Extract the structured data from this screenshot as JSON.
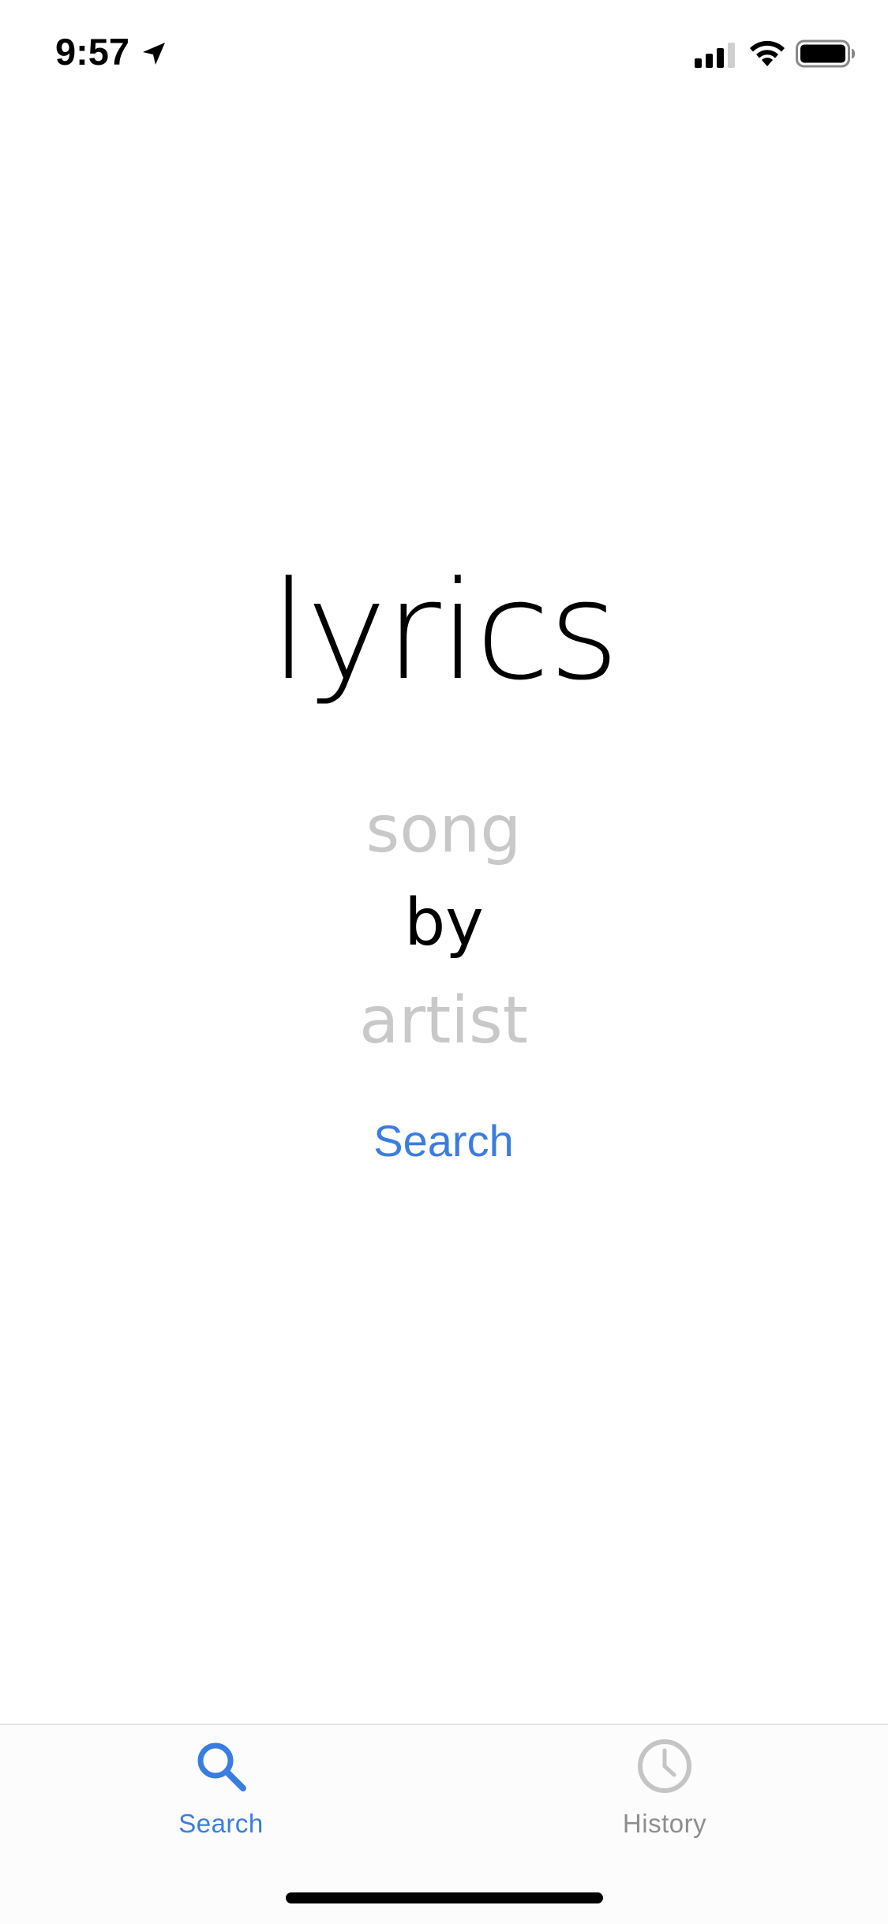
{
  "status_bar": {
    "time": "9:57",
    "icons": [
      "location-arrow-icon",
      "cellular-signal-icon",
      "wifi-icon",
      "battery-icon"
    ]
  },
  "main": {
    "title": "lyrics",
    "song_placeholder": "song",
    "by_label": "by",
    "artist_placeholder": "artist",
    "search_label": "Search"
  },
  "tab_bar": {
    "tabs": [
      {
        "label": "Search",
        "icon": "search-icon",
        "selected": true
      },
      {
        "label": "History",
        "icon": "clock-icon",
        "selected": false
      }
    ]
  },
  "colors": {
    "accent": "#3a7de0",
    "placeholder": "#c8c8c8",
    "tab_inactive": "#8e8e8e"
  }
}
